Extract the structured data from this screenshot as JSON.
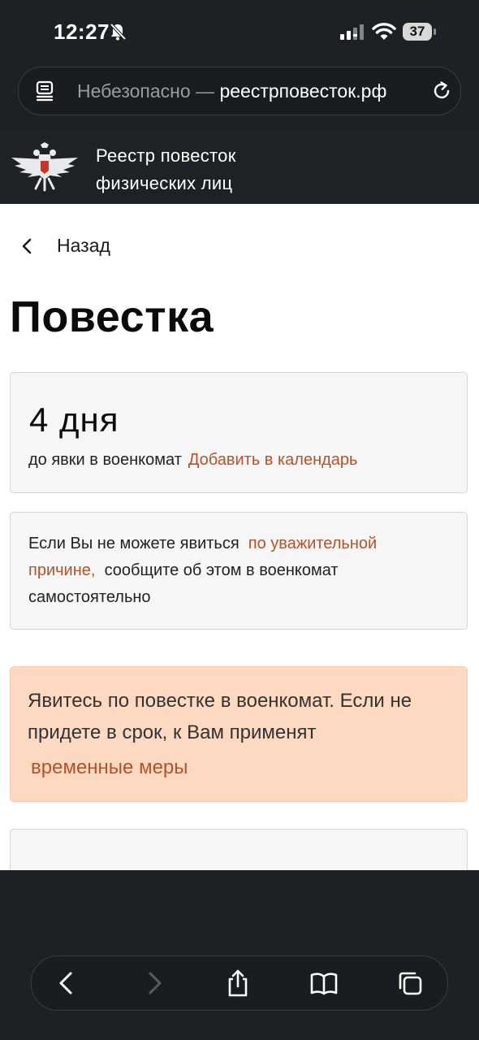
{
  "status_bar": {
    "time": "12:27",
    "battery_level": "37"
  },
  "browser": {
    "url_insecure_label": "Небезопасно —",
    "url_domain": "реестрповесток.рф"
  },
  "site": {
    "title_line1": "Реестр повесток",
    "title_line2": "физических лиц"
  },
  "nav": {
    "back_label": "Назад"
  },
  "page": {
    "title": "Повестка",
    "days": {
      "count": "4 дня",
      "caption": "до явки в военкомат",
      "calendar_link": "Добавить в календарь"
    },
    "notice": {
      "text_before": "Если Вы не можете явиться",
      "link": "по уважительной причине,",
      "text_after": "сообщите об этом в военкомат самостоятельно"
    },
    "warning": {
      "text": "Явитесь по повестке в военкомат. Если не придете в срок, к Вам применят",
      "link": "временные меры"
    }
  },
  "colors": {
    "link": "#b4532a",
    "warning_bg": "#fcd9c0",
    "dark_chrome": "#1f2023"
  },
  "icons": {
    "status": [
      "bell-slash-icon",
      "cellular-signal-icon",
      "wifi-icon",
      "battery-icon"
    ],
    "url_bar": [
      "reader-mode-icon",
      "reload-icon"
    ],
    "toolbar": [
      "back-arrow-icon",
      "forward-arrow-icon",
      "share-icon",
      "bookmarks-icon",
      "tabs-icon"
    ]
  }
}
